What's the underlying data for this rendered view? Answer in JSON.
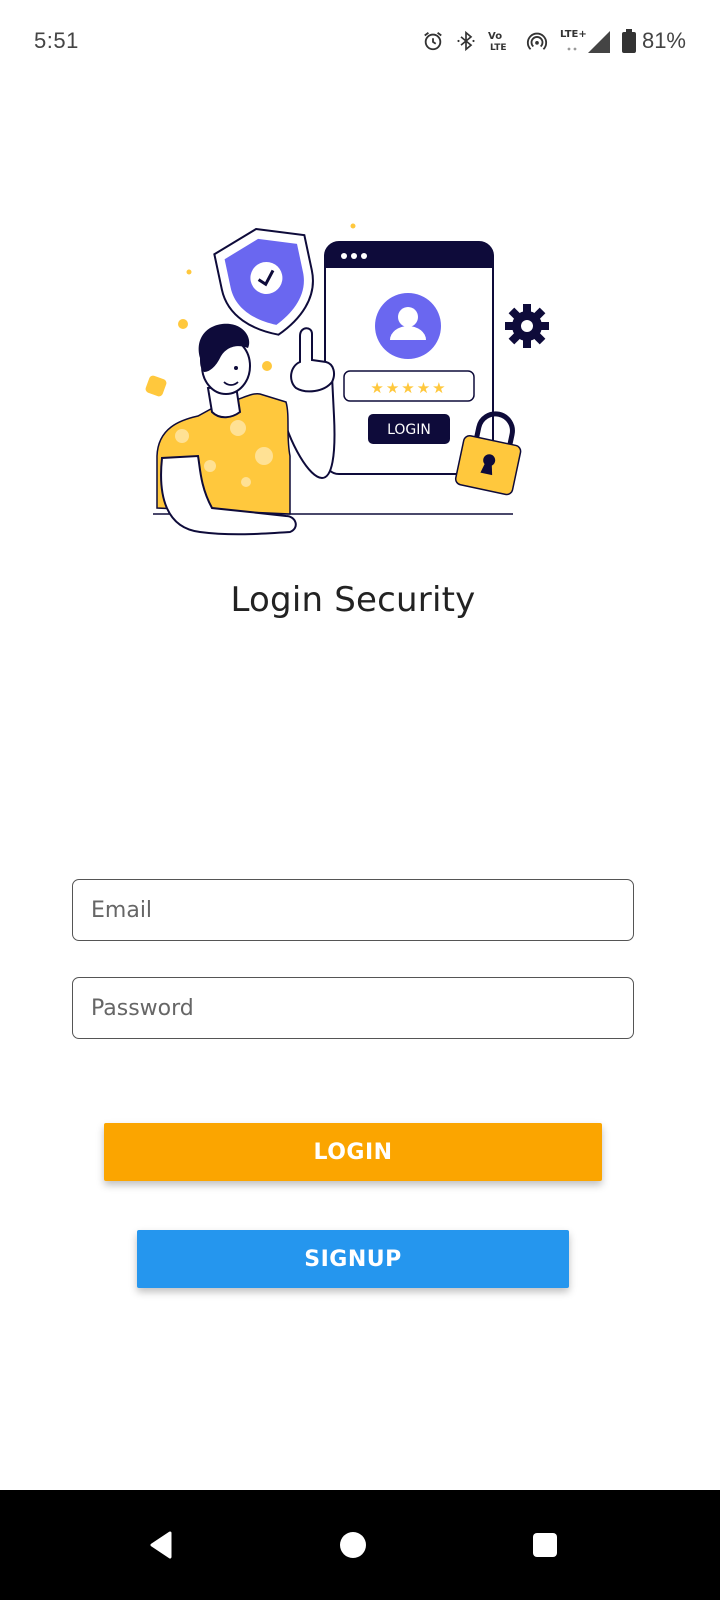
{
  "status_bar": {
    "time": "5:51",
    "battery": "81%",
    "volte_label_top": "Vo",
    "volte_label_bottom": "LTE",
    "lte_label": "LTE+",
    "icons": [
      "alarm-icon",
      "bluetooth-icon",
      "volte-icon",
      "hotspot-icon",
      "lte-signal-icon",
      "battery-icon"
    ]
  },
  "illustration": {
    "title": "Login Security",
    "screen_button_label": "LOGIN",
    "password_mask": "★★★★★",
    "colors": {
      "accent_purple": "#6A67F0",
      "yellow": "#FFC83D",
      "navy": "#0E0B3A"
    }
  },
  "form": {
    "email_placeholder": "Email",
    "password_placeholder": "Password"
  },
  "buttons": {
    "login_label": "LOGIN",
    "login_color": "#FBA500",
    "signup_label": "SIGNUP",
    "signup_color": "#2596EE"
  },
  "nav_bar": {
    "icons": [
      "back-icon",
      "home-icon",
      "recents-icon"
    ]
  }
}
